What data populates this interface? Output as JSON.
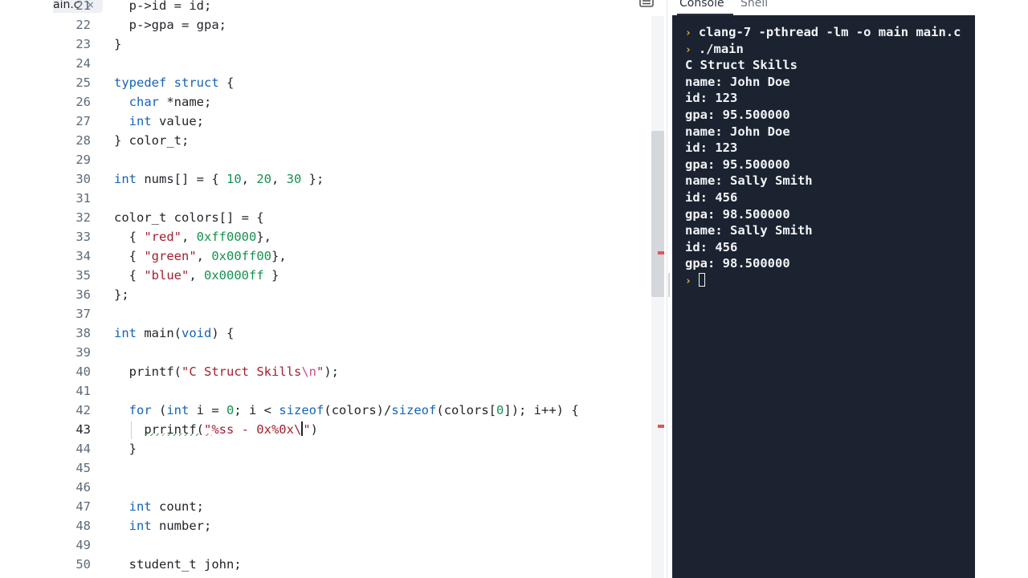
{
  "editor": {
    "file_tab": "ain.c",
    "file_tab_close": "×",
    "lines": [
      {
        "n": "21",
        "segs": [
          {
            "t": "  p->id = id;",
            "c": ""
          }
        ]
      },
      {
        "n": "22",
        "segs": [
          {
            "t": "  p->gpa = gpa;",
            "c": ""
          }
        ]
      },
      {
        "n": "23",
        "segs": [
          {
            "t": "}",
            "c": ""
          }
        ]
      },
      {
        "n": "24",
        "segs": []
      },
      {
        "n": "25",
        "segs": [
          {
            "t": "typedef",
            "c": "kw"
          },
          {
            "t": " ",
            "c": ""
          },
          {
            "t": "struct",
            "c": "kw"
          },
          {
            "t": " {",
            "c": ""
          }
        ]
      },
      {
        "n": "26",
        "segs": [
          {
            "t": "  ",
            "c": ""
          },
          {
            "t": "char",
            "c": "kw"
          },
          {
            "t": " *name;",
            "c": ""
          }
        ]
      },
      {
        "n": "27",
        "segs": [
          {
            "t": "  ",
            "c": ""
          },
          {
            "t": "int",
            "c": "kw"
          },
          {
            "t": " value;",
            "c": ""
          }
        ]
      },
      {
        "n": "28",
        "segs": [
          {
            "t": "} color_t;",
            "c": ""
          }
        ]
      },
      {
        "n": "29",
        "segs": []
      },
      {
        "n": "30",
        "segs": [
          {
            "t": "int",
            "c": "kw"
          },
          {
            "t": " nums[] = { ",
            "c": ""
          },
          {
            "t": "10",
            "c": "num"
          },
          {
            "t": ", ",
            "c": ""
          },
          {
            "t": "20",
            "c": "num"
          },
          {
            "t": ", ",
            "c": ""
          },
          {
            "t": "30",
            "c": "num"
          },
          {
            "t": " };",
            "c": ""
          }
        ]
      },
      {
        "n": "31",
        "segs": []
      },
      {
        "n": "32",
        "segs": [
          {
            "t": "color_t colors[] = {",
            "c": ""
          }
        ]
      },
      {
        "n": "33",
        "segs": [
          {
            "t": "  { ",
            "c": ""
          },
          {
            "t": "\"red\"",
            "c": "str"
          },
          {
            "t": ", ",
            "c": ""
          },
          {
            "t": "0xff0000",
            "c": "num"
          },
          {
            "t": "},",
            "c": ""
          }
        ]
      },
      {
        "n": "34",
        "segs": [
          {
            "t": "  { ",
            "c": ""
          },
          {
            "t": "\"green\"",
            "c": "str"
          },
          {
            "t": ", ",
            "c": ""
          },
          {
            "t": "0x00ff00",
            "c": "num"
          },
          {
            "t": "},",
            "c": ""
          }
        ]
      },
      {
        "n": "35",
        "segs": [
          {
            "t": "  { ",
            "c": ""
          },
          {
            "t": "\"blue\"",
            "c": "str"
          },
          {
            "t": ", ",
            "c": ""
          },
          {
            "t": "0x0000ff",
            "c": "num"
          },
          {
            "t": " }",
            "c": ""
          }
        ]
      },
      {
        "n": "36",
        "segs": [
          {
            "t": "};",
            "c": ""
          }
        ]
      },
      {
        "n": "37",
        "segs": []
      },
      {
        "n": "38",
        "segs": [
          {
            "t": "int",
            "c": "kw"
          },
          {
            "t": " main(",
            "c": ""
          },
          {
            "t": "void",
            "c": "kw"
          },
          {
            "t": ") {",
            "c": ""
          }
        ]
      },
      {
        "n": "39",
        "segs": []
      },
      {
        "n": "40",
        "segs": [
          {
            "t": "  printf(",
            "c": ""
          },
          {
            "t": "\"C Struct Skills",
            "c": "str"
          },
          {
            "t": "\\n",
            "c": "esc"
          },
          {
            "t": "\"",
            "c": "str"
          },
          {
            "t": ");",
            "c": ""
          }
        ]
      },
      {
        "n": "41",
        "segs": []
      },
      {
        "n": "42",
        "segs": [
          {
            "t": "  ",
            "c": ""
          },
          {
            "t": "for",
            "c": "kw"
          },
          {
            "t": " (",
            "c": ""
          },
          {
            "t": "int",
            "c": "kw"
          },
          {
            "t": " i = ",
            "c": ""
          },
          {
            "t": "0",
            "c": "num"
          },
          {
            "t": "; i < ",
            "c": ""
          },
          {
            "t": "sizeof",
            "c": "fn"
          },
          {
            "t": "(colors)/",
            "c": ""
          },
          {
            "t": "sizeof",
            "c": "fn"
          },
          {
            "t": "(colors[",
            "c": ""
          },
          {
            "t": "0",
            "c": "num"
          },
          {
            "t": "]); i++) {",
            "c": ""
          }
        ]
      },
      {
        "n": "43",
        "active": true,
        "segs": [
          {
            "t": "    prrintf(",
            "c": ""
          },
          {
            "t": "\"%ss - 0x%0x\\",
            "c": "str"
          },
          {
            "t": "CURSOR",
            "c": "cursor"
          },
          {
            "t": "\"",
            "c": "str"
          },
          {
            "t": ")",
            "c": ""
          }
        ]
      },
      {
        "n": "44",
        "segs": [
          {
            "t": "  }",
            "c": ""
          }
        ]
      },
      {
        "n": "45",
        "segs": []
      },
      {
        "n": "46",
        "segs": []
      },
      {
        "n": "47",
        "segs": [
          {
            "t": "  ",
            "c": ""
          },
          {
            "t": "int",
            "c": "kw"
          },
          {
            "t": " count;",
            "c": ""
          }
        ]
      },
      {
        "n": "48",
        "segs": [
          {
            "t": "  ",
            "c": ""
          },
          {
            "t": "int",
            "c": "kw"
          },
          {
            "t": " number;",
            "c": ""
          }
        ]
      },
      {
        "n": "49",
        "segs": []
      },
      {
        "n": "50",
        "segs": [
          {
            "t": "  student_t john;",
            "c": ""
          }
        ]
      }
    ]
  },
  "console": {
    "tabs": [
      "Console",
      "Shell"
    ],
    "prompt_symbol": "›",
    "lines": [
      {
        "prompt": true,
        "text": "clang-7 -pthread -lm -o main main.c"
      },
      {
        "prompt": true,
        "text": "./main"
      },
      {
        "prompt": false,
        "text": "C Struct Skills"
      },
      {
        "prompt": false,
        "text": "name: John Doe"
      },
      {
        "prompt": false,
        "text": "id: 123"
      },
      {
        "prompt": false,
        "text": "gpa: 95.500000"
      },
      {
        "prompt": false,
        "text": "name: John Doe"
      },
      {
        "prompt": false,
        "text": "id: 123"
      },
      {
        "prompt": false,
        "text": "gpa: 95.500000"
      },
      {
        "prompt": false,
        "text": "name: Sally Smith"
      },
      {
        "prompt": false,
        "text": "id: 456"
      },
      {
        "prompt": false,
        "text": "gpa: 98.500000"
      },
      {
        "prompt": false,
        "text": "name: Sally Smith"
      },
      {
        "prompt": false,
        "text": "id: 456"
      },
      {
        "prompt": false,
        "text": "gpa: 98.500000"
      },
      {
        "prompt": true,
        "text": "",
        "cursor": true
      }
    ]
  },
  "colors": {
    "console_bg": "#1b2330",
    "keyword": "#1463b8",
    "number": "#15924e",
    "string": "#a3202f",
    "prompt": "#e0b94a",
    "error_marker": "#e25555"
  }
}
